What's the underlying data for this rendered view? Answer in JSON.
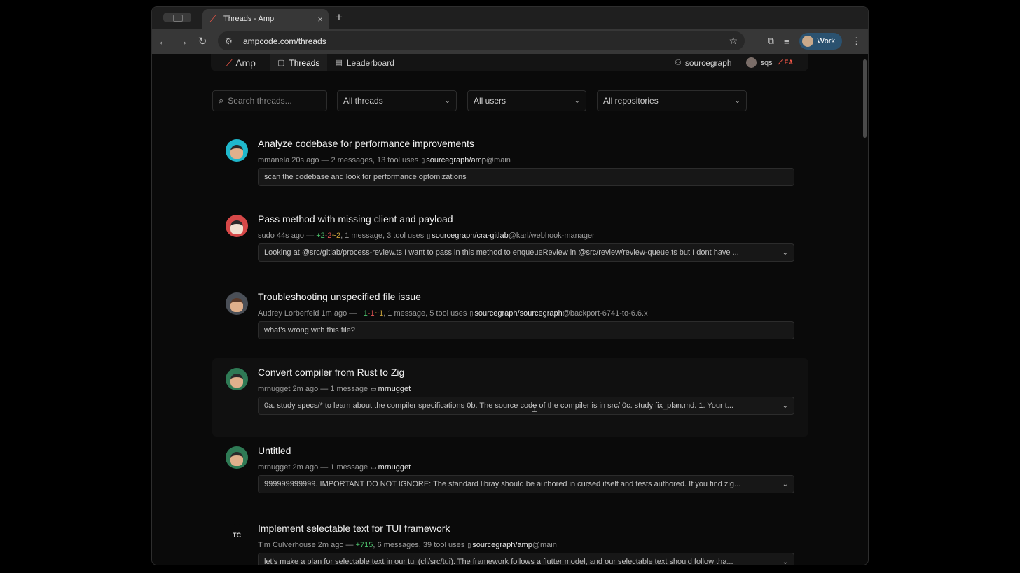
{
  "browser": {
    "tab_title": "Threads - Amp",
    "url": "ampcode.com/threads",
    "profile_name": "Work"
  },
  "header": {
    "brand": "Amp",
    "nav": [
      "Threads",
      "Leaderboard"
    ],
    "org": "sourcegraph",
    "user": "sqs",
    "badge": "EA"
  },
  "filters": {
    "search_placeholder": "Search threads...",
    "threads": "All threads",
    "users": "All users",
    "repositories": "All repositories"
  },
  "colors": {
    "accent": "#ff5a4a",
    "added": "#4cc06b",
    "removed": "#e05454",
    "modified": "#c9a23a"
  },
  "threads": [
    {
      "title": "Analyze codebase for performance improvements",
      "meta": "mmanela 20s ago — 2 messages, 13 tool uses",
      "repo": "sourcegraph/amp",
      "branch": "@main",
      "message": "scan the codebase and look for performance optomizations"
    },
    {
      "title": "Pass method with missing client and payload",
      "meta_prefix": "sudo 44s ago —",
      "added": "+2",
      "removed": "-2",
      "modified": "~2",
      "meta_suffix": ", 1 message, 3 tool uses",
      "repo": "sourcegraph/cra-gitlab",
      "branch": "@karl/webhook-manager",
      "message": "Looking at @src/gitlab/process-review.ts I want to pass in this method to enqueueReview in @src/review/review-queue.ts but I dont have ..."
    },
    {
      "title": "Troubleshooting unspecified file issue",
      "meta_prefix": "Audrey Lorberfeld 1m ago —",
      "added": "+1",
      "removed": "-1",
      "modified": "~1",
      "meta_suffix": ", 1 message, 5 tool uses",
      "repo": "sourcegraph/sourcegraph",
      "branch": "@backport-6741-to-6.6.x",
      "message": "what's wrong with this file?"
    },
    {
      "title": "Convert compiler from Rust to Zig",
      "meta": "mrnugget 2m ago — 1 message",
      "folder": "mrnugget",
      "message": "0a. study specs/* to learn about the compiler specifications 0b. The source code of the compiler is in src/ 0c. study fix_plan.md. 1. Your t..."
    },
    {
      "title": "Untitled",
      "meta": "mrnugget 2m ago — 1 message",
      "folder": "mrnugget",
      "message": "999999999999. IMPORTANT DO NOT IGNORE: The standard libray should be authored in cursed itself and tests authored. If you find zig..."
    },
    {
      "title": "Implement selectable text for TUI framework",
      "initials": "TC",
      "meta_prefix": "Tim Culverhouse 2m ago —",
      "added": "+715",
      "meta_suffix": ", 6 messages, 39 tool uses",
      "repo": "sourcegraph/amp",
      "branch": "@main",
      "message": "let's make a plan for selectable text in our tui (cli/src/tui). The framework follows a flutter model, and our selectable text should follow tha..."
    }
  ]
}
